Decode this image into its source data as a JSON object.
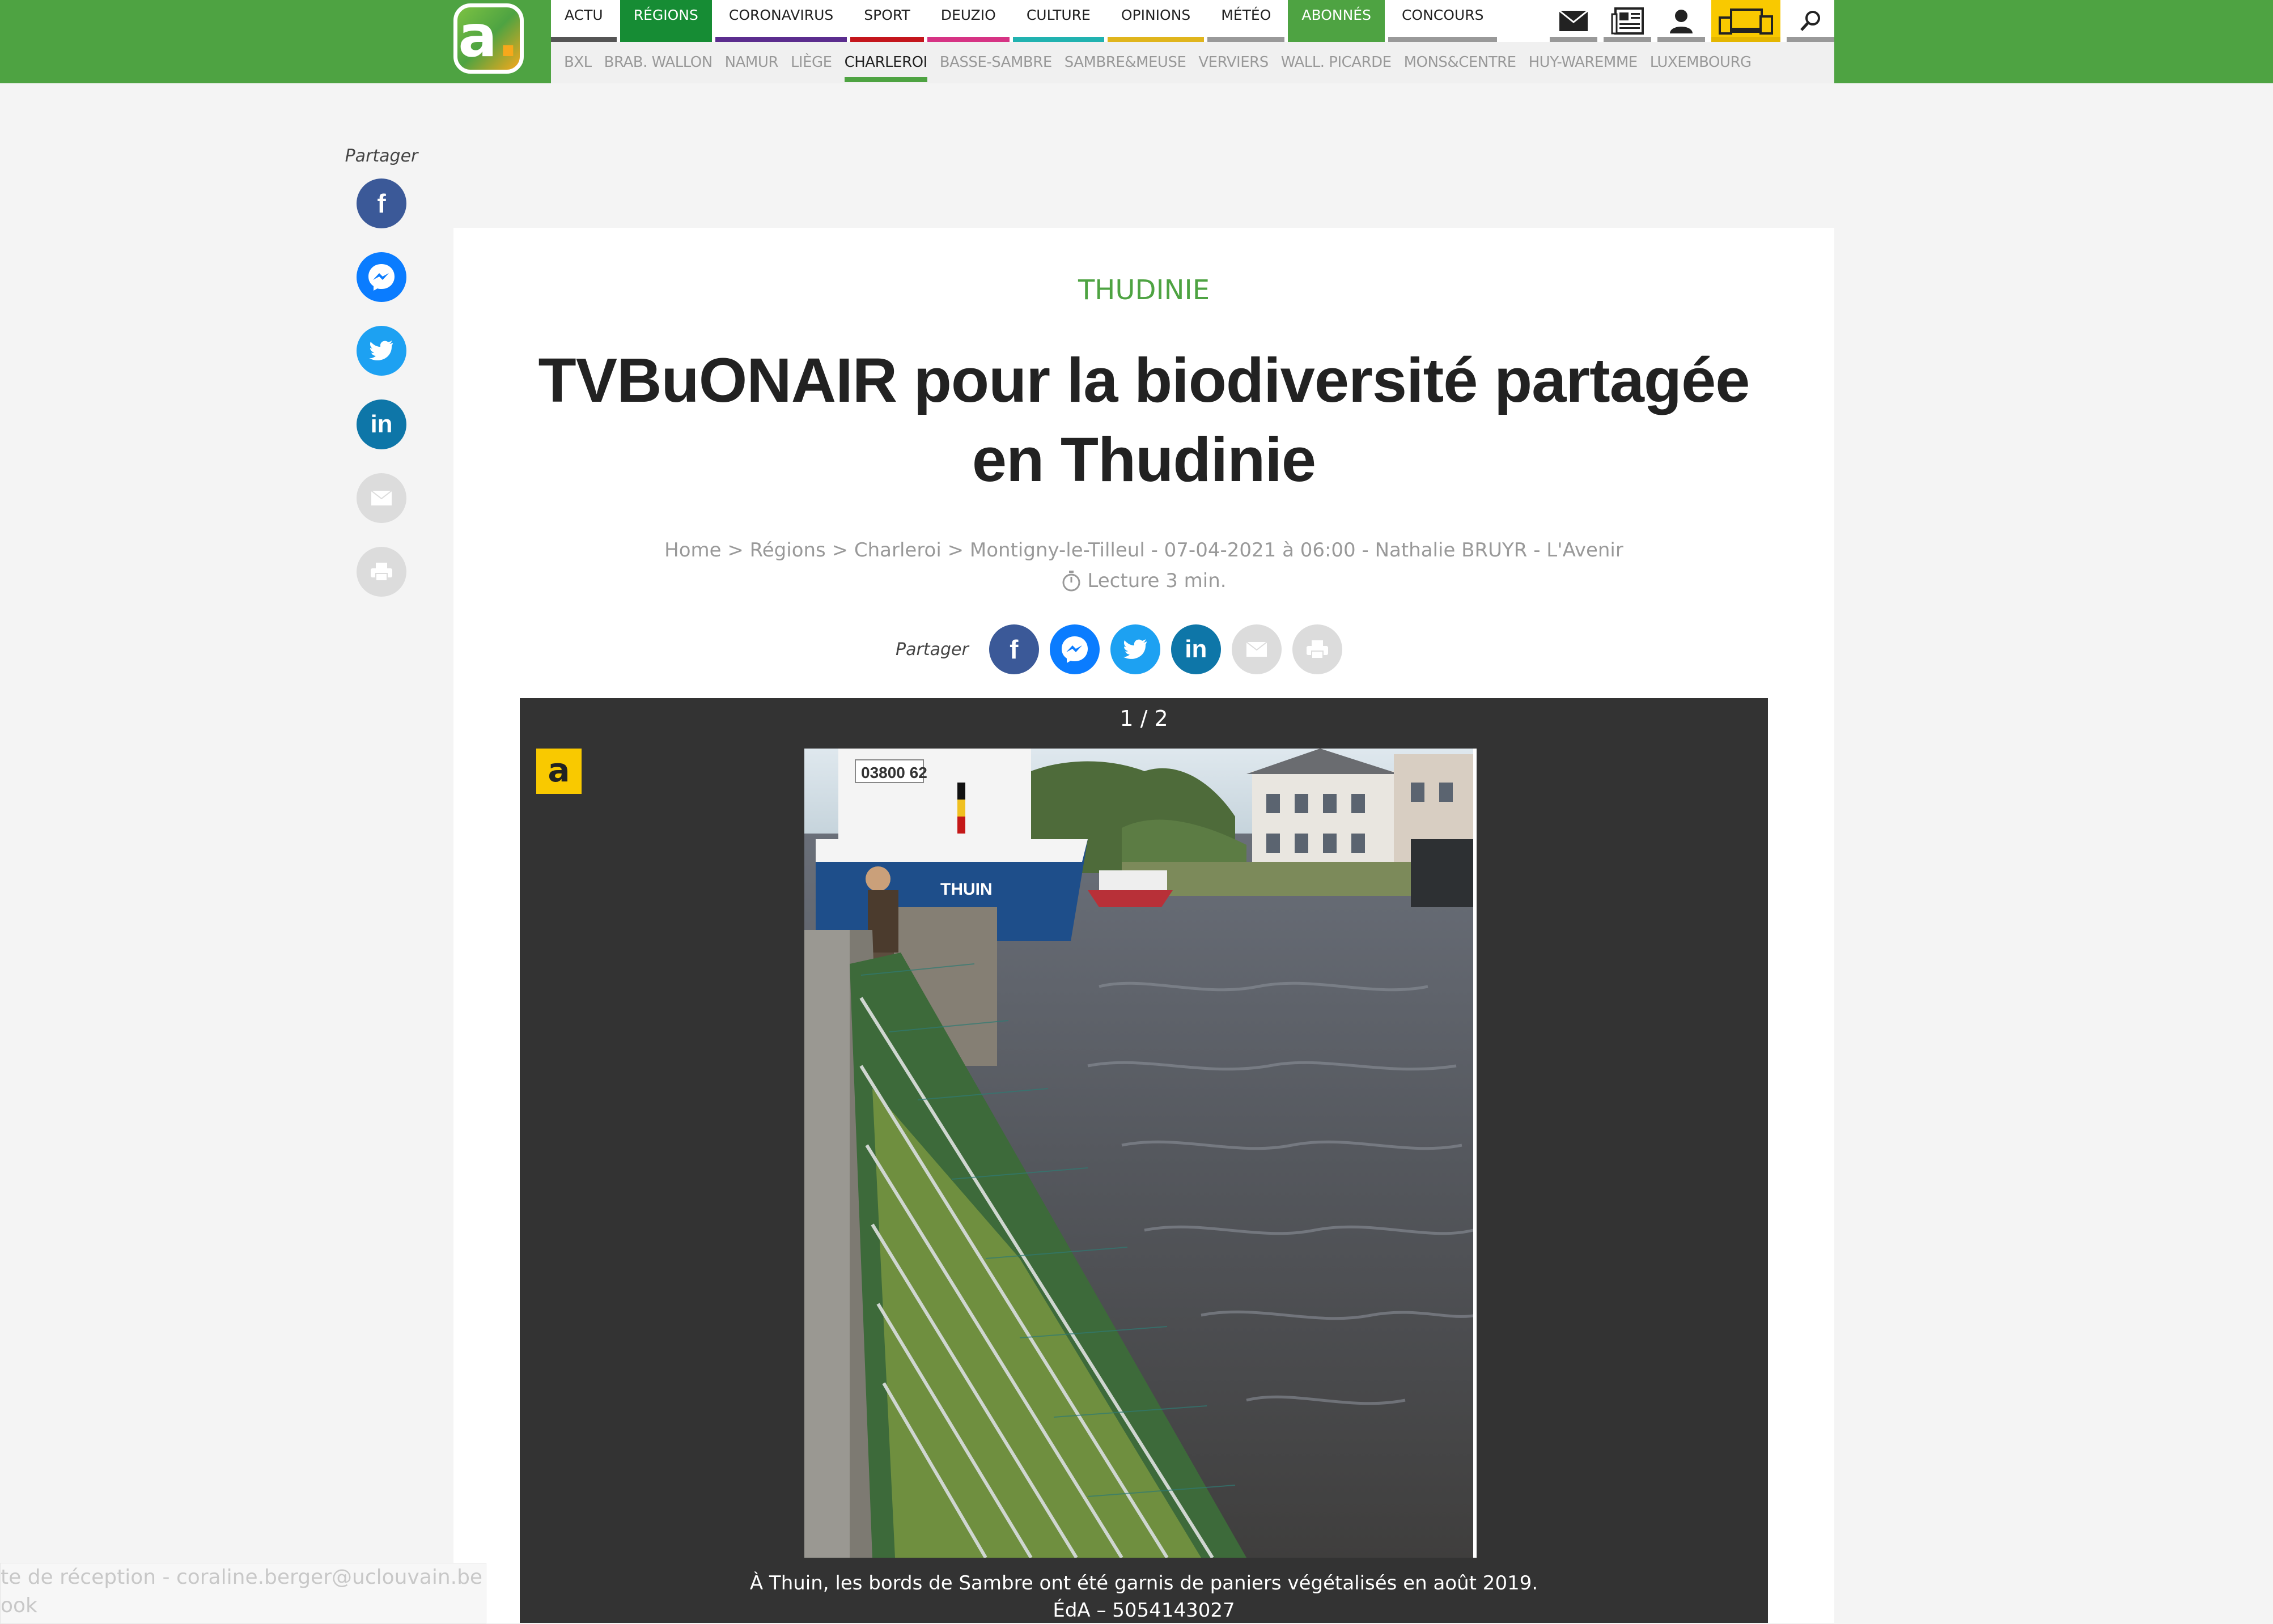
{
  "header": {
    "logo_letter": "a",
    "logo_dot": ".",
    "main_nav": [
      {
        "label": "ACTU",
        "color": "#555555"
      },
      {
        "label": "RÉGIONS",
        "color": "#168c34"
      },
      {
        "label": "CORONAVIRUS",
        "color": "#5b2d8e"
      },
      {
        "label": "SPORT",
        "color": "#c4161c"
      },
      {
        "label": "DEUZIO",
        "color": "#d63384"
      },
      {
        "label": "CULTURE",
        "color": "#21b2b0"
      },
      {
        "label": "OPINIONS",
        "color": "#e0b51d"
      },
      {
        "label": "MÉTÉO",
        "color": "#999999"
      },
      {
        "label": "ABONNÉS",
        "color": "#4ea342"
      },
      {
        "label": "CONCOURS",
        "color": "#999999"
      }
    ],
    "sub_nav": [
      "BXL",
      "BRAB. WALLON",
      "NAMUR",
      "LIÈGE",
      "CHARLEROI",
      "BASSE-SAMBRE",
      "SAMBRE&MEUSE",
      "VERVIERS",
      "WALL. PICARDE",
      "MONS&CENTRE",
      "HUY-WAREMME",
      "LUXEMBOURG"
    ],
    "active_sub": "CHARLEROI",
    "tools": [
      "mail-icon",
      "newspaper-icon",
      "user-icon",
      "devices-icon",
      "search-icon"
    ]
  },
  "share": {
    "label": "Partager",
    "networks": [
      "facebook-icon",
      "messenger-icon",
      "twitter-icon",
      "linkedin-icon",
      "mail-icon",
      "print-icon"
    ]
  },
  "article": {
    "kicker": "THUDINIE",
    "title": "TVBuONAIR pour la biodiversité partagée en Thudinie",
    "breadcrumb": "Home > Régions > Charleroi > Montigny-le-Tilleul - 07-04-2021 à 06:00 - Nathalie BRUYR - L'Avenir",
    "reading_time": "Lecture 3 min."
  },
  "gallery": {
    "counter": "1 / 2",
    "badge": "a",
    "photo_boat_id": "03800 62",
    "photo_boat_name": "THUIN",
    "caption_line1": "À Thuin, les bords de Sambre ont été garnis de paniers végétalisés en août 2019.",
    "caption_line2": "ÉdA – 5054143027"
  },
  "notification": {
    "text": "te de réception - coraline.berger@uclouvain.be -",
    "text2": "ook"
  },
  "colors": {
    "brand_green": "#4ea342",
    "active_green": "#168c34",
    "accent_yellow": "#f9c900"
  }
}
